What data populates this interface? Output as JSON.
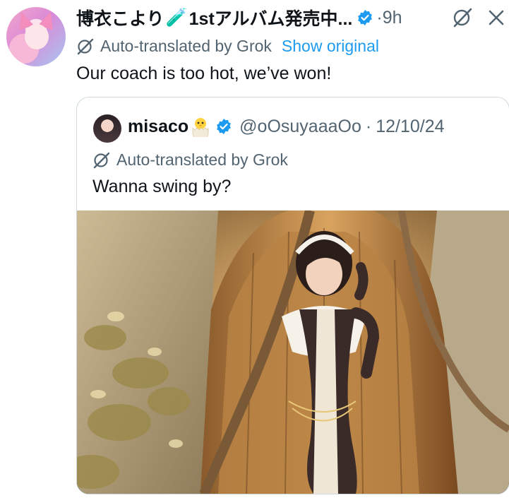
{
  "tweet": {
    "display_name": "博衣こより",
    "name_emoji": "🧪",
    "name_suffix": "1stアルバム発売中...",
    "time": "9h",
    "translation_note": "Auto-translated by Grok",
    "show_original": "Show original",
    "text": "Our coach is too hot, we’ve won!"
  },
  "quote": {
    "display_name": "misaco",
    "name_emoji": "🐣",
    "handle": "@oOsuyaaaOo",
    "separator": "·",
    "date": "12/10/24",
    "translation_note": "Auto-translated by Grok",
    "text": "Wanna swing by?"
  },
  "colors": {
    "accent": "#1d9bf0",
    "secondary_text": "#536471",
    "primary_text": "#0f1419",
    "border": "#cfd9de"
  },
  "icons": {
    "verified": "verified-badge-icon",
    "grok": "grok-icon",
    "close": "close-icon",
    "translate": "grok-translate-icon"
  }
}
